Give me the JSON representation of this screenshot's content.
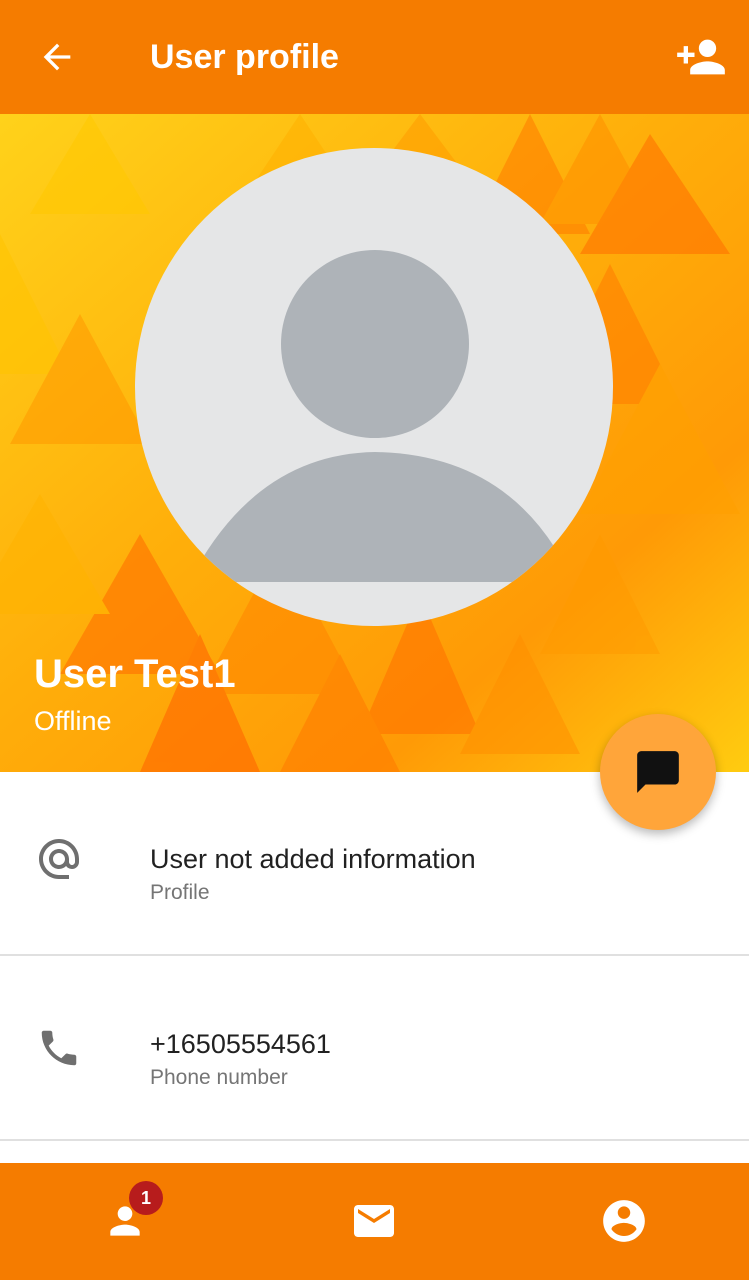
{
  "header": {
    "title": "User profile",
    "back_icon": "arrow-back-icon",
    "add_icon": "person-add-icon"
  },
  "profile": {
    "name": "User Test1",
    "status": "Offline",
    "avatar_icon": "default-avatar-icon"
  },
  "fab": {
    "icon": "chat-icon"
  },
  "details": [
    {
      "icon": "at-sign-icon",
      "value": "User not added information",
      "label": "Profile"
    },
    {
      "icon": "phone-icon",
      "value": "+16505554561",
      "label": "Phone number"
    }
  ],
  "bottom_nav": {
    "items": [
      {
        "icon": "contacts-icon",
        "badge": "1"
      },
      {
        "icon": "mail-icon"
      },
      {
        "icon": "account-circle-icon"
      }
    ]
  },
  "colors": {
    "primary": "#f57c00",
    "accent": "#ffa53a",
    "badge": "#b71c1c",
    "avatar_bg": "#e5e6e7",
    "avatar_fg": "#aeb3b8"
  }
}
